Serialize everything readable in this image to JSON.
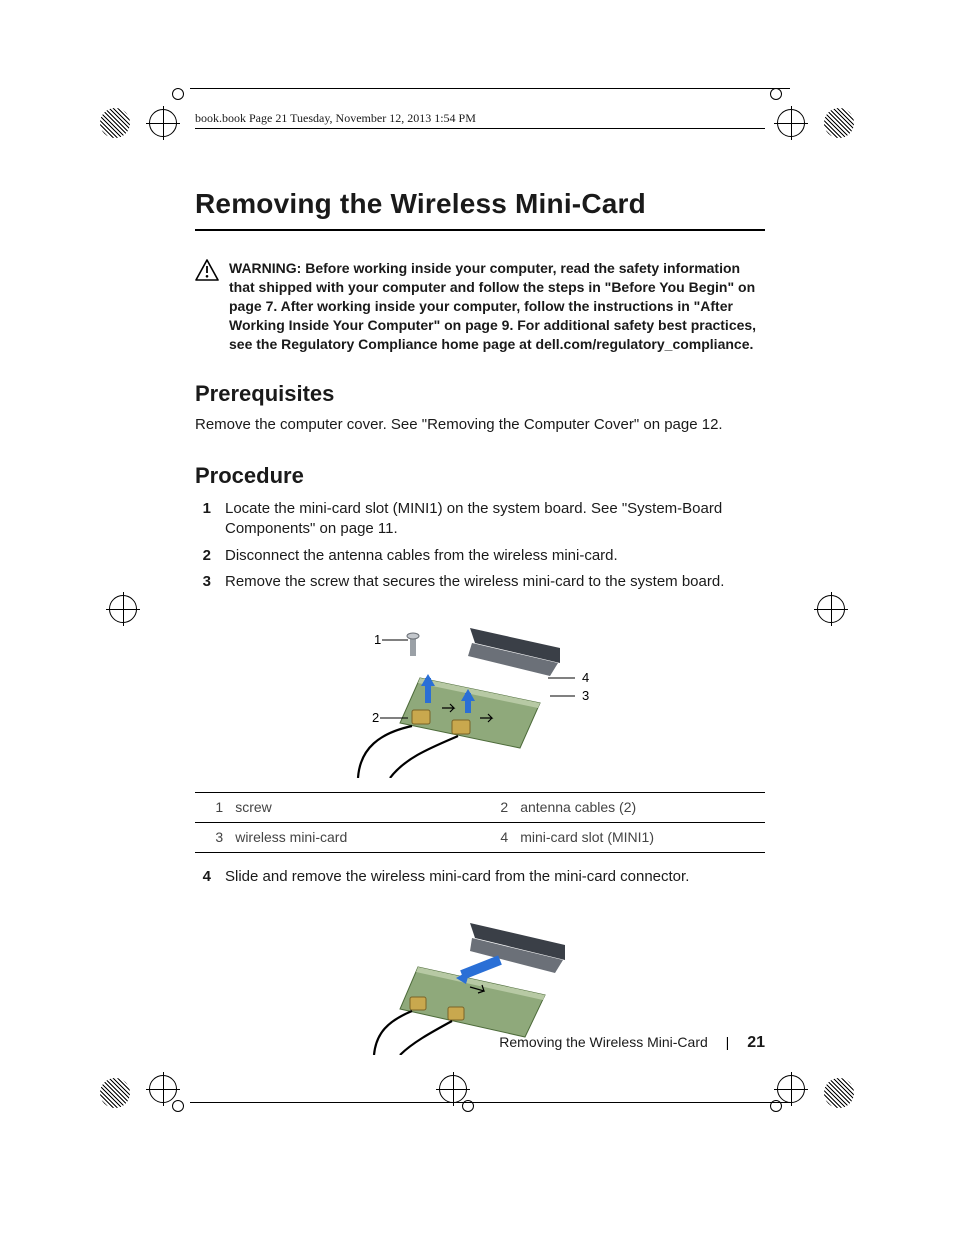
{
  "running_head": "book.book  Page 21  Tuesday, November 12, 2013  1:54 PM",
  "title": "Removing the Wireless Mini-Card",
  "warning": {
    "label": "WARNING:  ",
    "text": "Before working inside your computer, read the safety information that shipped with your computer and follow the steps in \"Before You Begin\" on page 7. After working inside your computer, follow the instructions in \"After Working Inside Your Computer\" on page 9. For additional safety best practices, see the Regulatory Compliance home page at dell.com/regulatory_compliance."
  },
  "sections": {
    "prerequisites": {
      "heading": "Prerequisites",
      "text": "Remove the computer cover. See \"Removing the Computer Cover\" on page 12."
    },
    "procedure": {
      "heading": "Procedure",
      "steps": [
        {
          "n": "1",
          "text": "Locate the mini-card slot (MINI1) on the system board. See \"System-Board Components\" on page 11."
        },
        {
          "n": "2",
          "text": "Disconnect the antenna cables from the wireless mini-card."
        },
        {
          "n": "3",
          "text": "Remove the screw that secures the wireless mini-card to the system board."
        },
        {
          "n": "4",
          "text": "Slide and remove the wireless mini-card from the mini-card connector."
        }
      ]
    }
  },
  "legend": [
    [
      {
        "n": "1",
        "label": "screw"
      },
      {
        "n": "2",
        "label": "antenna cables (2)"
      }
    ],
    [
      {
        "n": "3",
        "label": "wireless mini-card"
      },
      {
        "n": "4",
        "label": "mini-card slot (MINI1)"
      }
    ]
  ],
  "callouts": {
    "c1": "1",
    "c2": "2",
    "c3": "3",
    "c4": "4"
  },
  "footer": {
    "title": "Removing the Wireless Mini-Card",
    "sep": "|",
    "page": "21"
  }
}
